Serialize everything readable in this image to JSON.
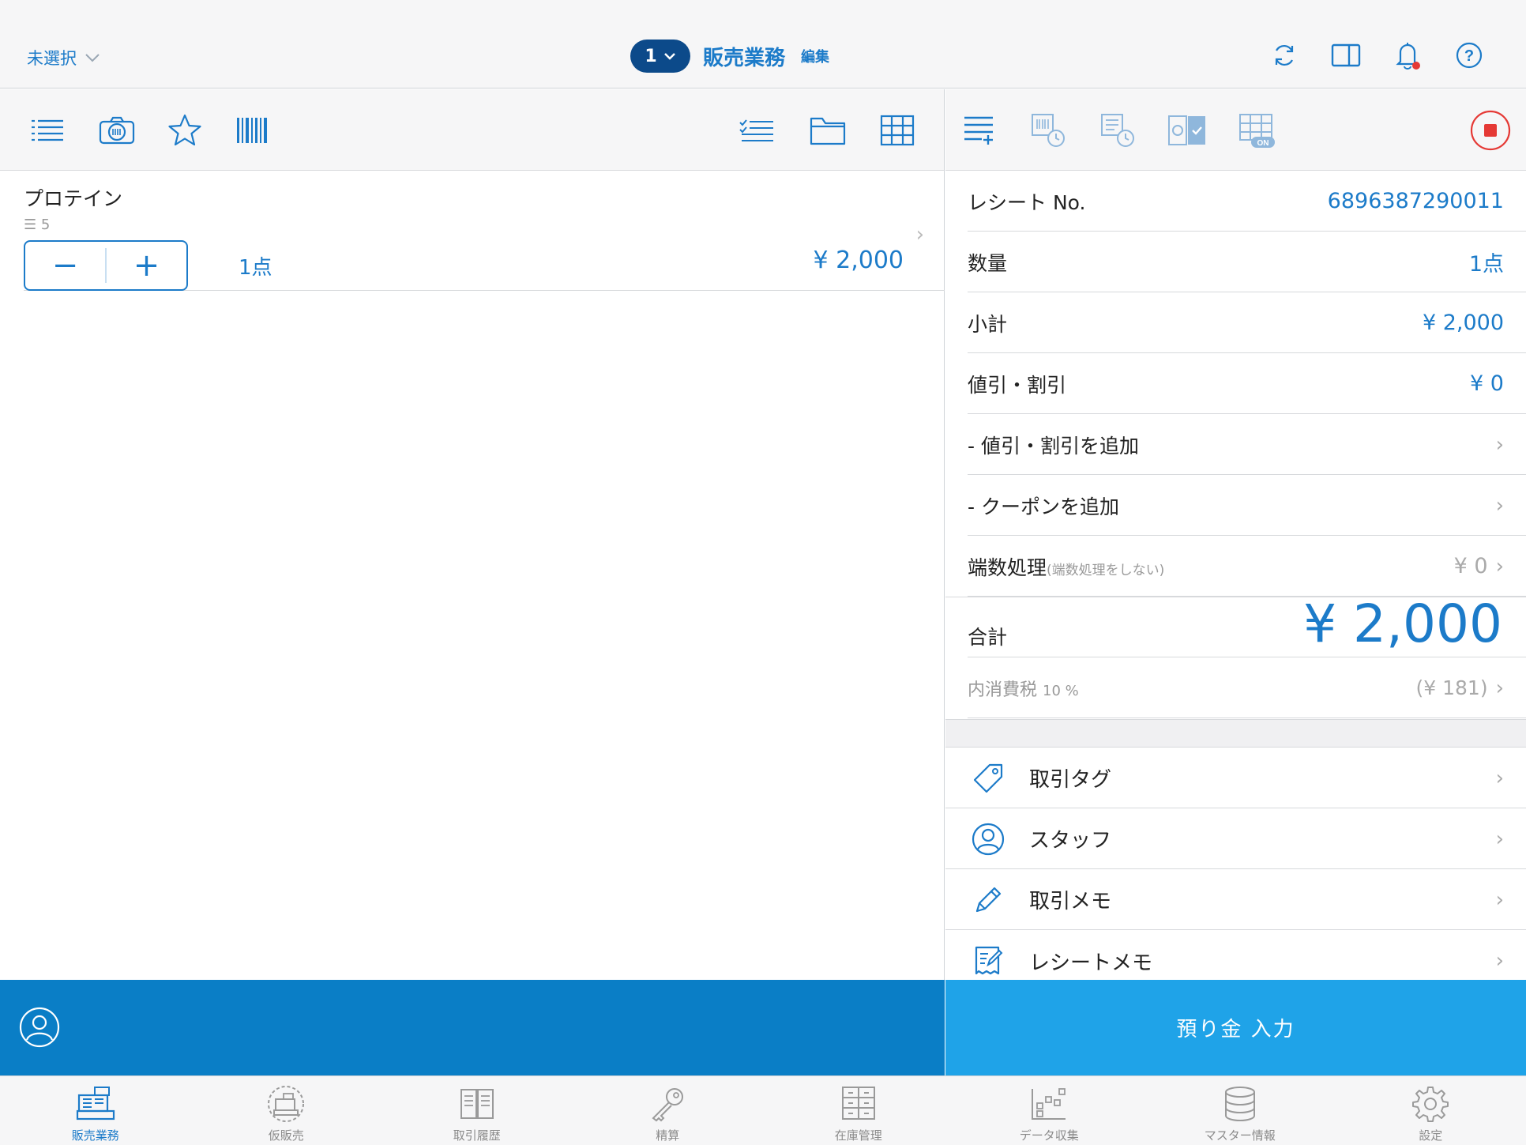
{
  "header": {
    "store_selector": "未選択",
    "register_number": "1",
    "title": "販売業務",
    "title_suffix": "編集",
    "colors": {
      "accent": "#1c7bc9",
      "pill": "#0c4a8a",
      "notification_dot": "#e53935"
    }
  },
  "items": [
    {
      "name": "プロテイン",
      "stock": "5",
      "qty": "1点",
      "price": "¥ 2,000"
    }
  ],
  "summary": {
    "receipt_label": "レシート No.",
    "receipt_value": "6896387290011",
    "qty_label": "数量",
    "qty_value": "1点",
    "subtotal_label": "小計",
    "subtotal_value": "¥ 2,000",
    "discount_label": "値引・割引",
    "discount_value": "¥ 0",
    "add_discount_label": "- 値引・割引を追加",
    "add_coupon_label": "- クーポンを追加",
    "rounding_label": "端数処理",
    "rounding_note": "(端数処理をしない)",
    "rounding_value": "¥ 0",
    "total_label": "合計",
    "total_value": "¥ 2,000",
    "tax_label": "内消費税",
    "tax_rate": "10 %",
    "tax_value": "(¥ 181)"
  },
  "menu": [
    {
      "label": "取引タグ",
      "icon": "tag-icon"
    },
    {
      "label": "スタッフ",
      "icon": "staff-icon"
    },
    {
      "label": "取引メモ",
      "icon": "pencil-icon"
    },
    {
      "label": "レシートメモ",
      "icon": "receipt-memo-icon"
    }
  ],
  "bottom": {
    "deposit_label": "預り金 入力",
    "colors": {
      "left_bar": "#0a7ec6",
      "right_bar": "#1fa3e8"
    }
  },
  "tabs": [
    {
      "label": "販売業務",
      "active": true
    },
    {
      "label": "仮販売"
    },
    {
      "label": "取引履歴"
    },
    {
      "label": "精算"
    },
    {
      "label": "在庫管理"
    },
    {
      "label": "データ収集"
    },
    {
      "label": "マスター情報"
    },
    {
      "label": "設定"
    }
  ]
}
